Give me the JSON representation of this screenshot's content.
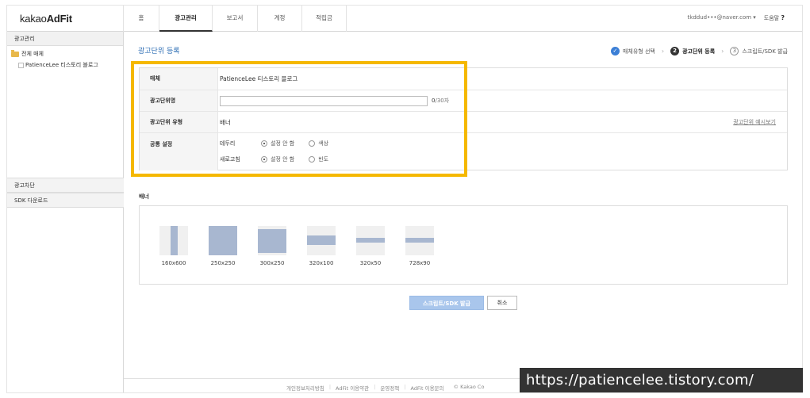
{
  "app": {
    "logo_light": "kakao",
    "logo_bold": "AdFit"
  },
  "nav": {
    "items": [
      "홈",
      "광고관리",
      "보고서",
      "계정",
      "적립금"
    ]
  },
  "user": {
    "email": "tkddud•••@naver.com ▾",
    "help": "도움말",
    "help_mark": "?"
  },
  "sidebar": {
    "header": "광고관리",
    "tree_root": "전체 매체",
    "tree_child": "PatienceLee 티스토리 블로그",
    "section_block": "광고차단",
    "section_sdk": "SDK 다운로드"
  },
  "page": {
    "title": "광고단위 등록"
  },
  "steps": [
    {
      "num": "✓",
      "label": "매체유형 선택",
      "state": "done"
    },
    {
      "num": "2",
      "label": "광고단위 등록",
      "state": "current"
    },
    {
      "num": "3",
      "label": "스크립트/SDK 발급",
      "state": "todo"
    }
  ],
  "form": {
    "media_label": "매체",
    "media_value": "PatienceLee 티스토리 블로그",
    "name_label": "광고단위명",
    "name_value": "",
    "name_count": "0",
    "name_max": "/30자",
    "type_label": "광고단위 유형",
    "type_value": "배너",
    "preview_link": "광고단위 예시보기",
    "common_label": "공통 설정",
    "border_label": "테두리",
    "border_opt1": "설정 안 함",
    "border_opt2": "색상",
    "refresh_label": "새로고침",
    "refresh_opt1": "설정 안 함",
    "refresh_opt2": "빈도"
  },
  "banner": {
    "title": "배너",
    "sizes": [
      "160x600",
      "250x250",
      "300x250",
      "320x100",
      "320x50",
      "728x90"
    ]
  },
  "actions": {
    "issue": "스크립트/SDK 발급",
    "cancel": "취소"
  },
  "footer": {
    "links": [
      "개인정보처리방침",
      "AdFit 이용약관",
      "운영정책",
      "AdFit 이용문의",
      "© Kakao Co"
    ]
  },
  "watermark": "https://patiencelee.tistory.com/",
  "colors": {
    "accent": "#2f6fb5",
    "highlight": "#f5b800",
    "primary_button": "#a9c6ec",
    "thumb_bar": "#a8b7d0"
  }
}
